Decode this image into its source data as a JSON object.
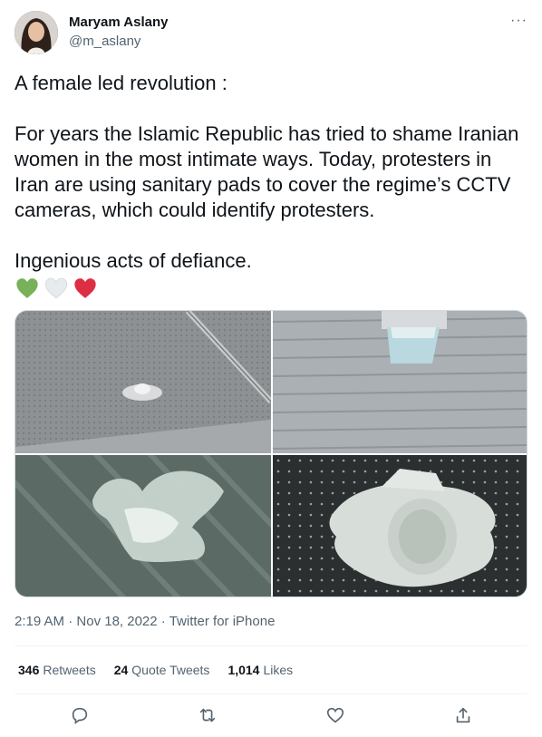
{
  "author": {
    "name": "Maryam Aslany",
    "handle": "@m_aslany",
    "more_label": "···"
  },
  "tweet": {
    "line1": "A female led revolution :",
    "para2": "For years the Islamic Republic has tried to shame Iranian women in the most intimate ways. Today, protesters in Iran are using sanitary pads to cover the regime’s CCTV cameras, which could identify protesters.",
    "line3": "Ingenious acts of defiance.",
    "hearts": [
      "green-heart",
      "white-heart",
      "red-heart"
    ]
  },
  "meta": {
    "time": "2:19 AM",
    "sep1": " · ",
    "date": "Nov 18, 2022",
    "sep2": " · ",
    "source": "Twitter for iPhone"
  },
  "stats": {
    "retweets_count": "346",
    "retweets_label": "Retweets",
    "quotes_count": "24",
    "quotes_label": "Quote Tweets",
    "likes_count": "1,014",
    "likes_label": "Likes"
  },
  "actions": [
    "reply-icon",
    "retweet-icon",
    "like-icon",
    "share-icon"
  ],
  "colors": {
    "text": "#0f1419",
    "secondary": "#536471",
    "divider": "#eff3f4",
    "heart_green": "#78b159",
    "heart_white": "#e1e8ed",
    "heart_red": "#dd2e44"
  }
}
